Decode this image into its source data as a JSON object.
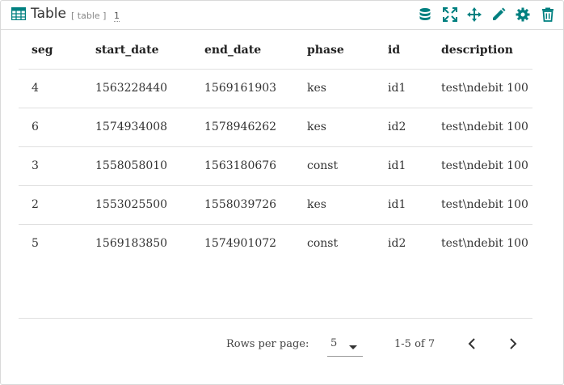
{
  "header": {
    "title": "Table",
    "subtype": "[ table ]",
    "count": "1",
    "tools": [
      {
        "name": "database-icon",
        "color": "#008080"
      },
      {
        "name": "fullscreen-icon",
        "color": "#008080"
      },
      {
        "name": "move-icon",
        "color": "#008080"
      },
      {
        "name": "edit-icon",
        "color": "#008080"
      },
      {
        "name": "settings-icon",
        "color": "#008080"
      },
      {
        "name": "delete-icon",
        "color": "#008080"
      }
    ]
  },
  "table": {
    "columns": [
      "seg",
      "start_date",
      "end_date",
      "phase",
      "id",
      "description"
    ],
    "rows": [
      [
        "4",
        "1563228440",
        "1569161903",
        "kes",
        "id1",
        "test\\ndebit 100"
      ],
      [
        "6",
        "1574934008",
        "1578946262",
        "kes",
        "id2",
        "test\\ndebit 100"
      ],
      [
        "3",
        "1558058010",
        "1563180676",
        "const",
        "id1",
        "test\\ndebit 100"
      ],
      [
        "2",
        "1553025500",
        "1558039726",
        "kes",
        "id1",
        "test\\ndebit 100"
      ],
      [
        "5",
        "1569183850",
        "1574901072",
        "const",
        "id2",
        "test\\ndebit 100"
      ]
    ]
  },
  "footer": {
    "rows_per_page_label": "Rows per page:",
    "rows_per_page_value": "5",
    "range_text": "1-5 of 7"
  },
  "colors": {
    "accent": "#008080"
  }
}
